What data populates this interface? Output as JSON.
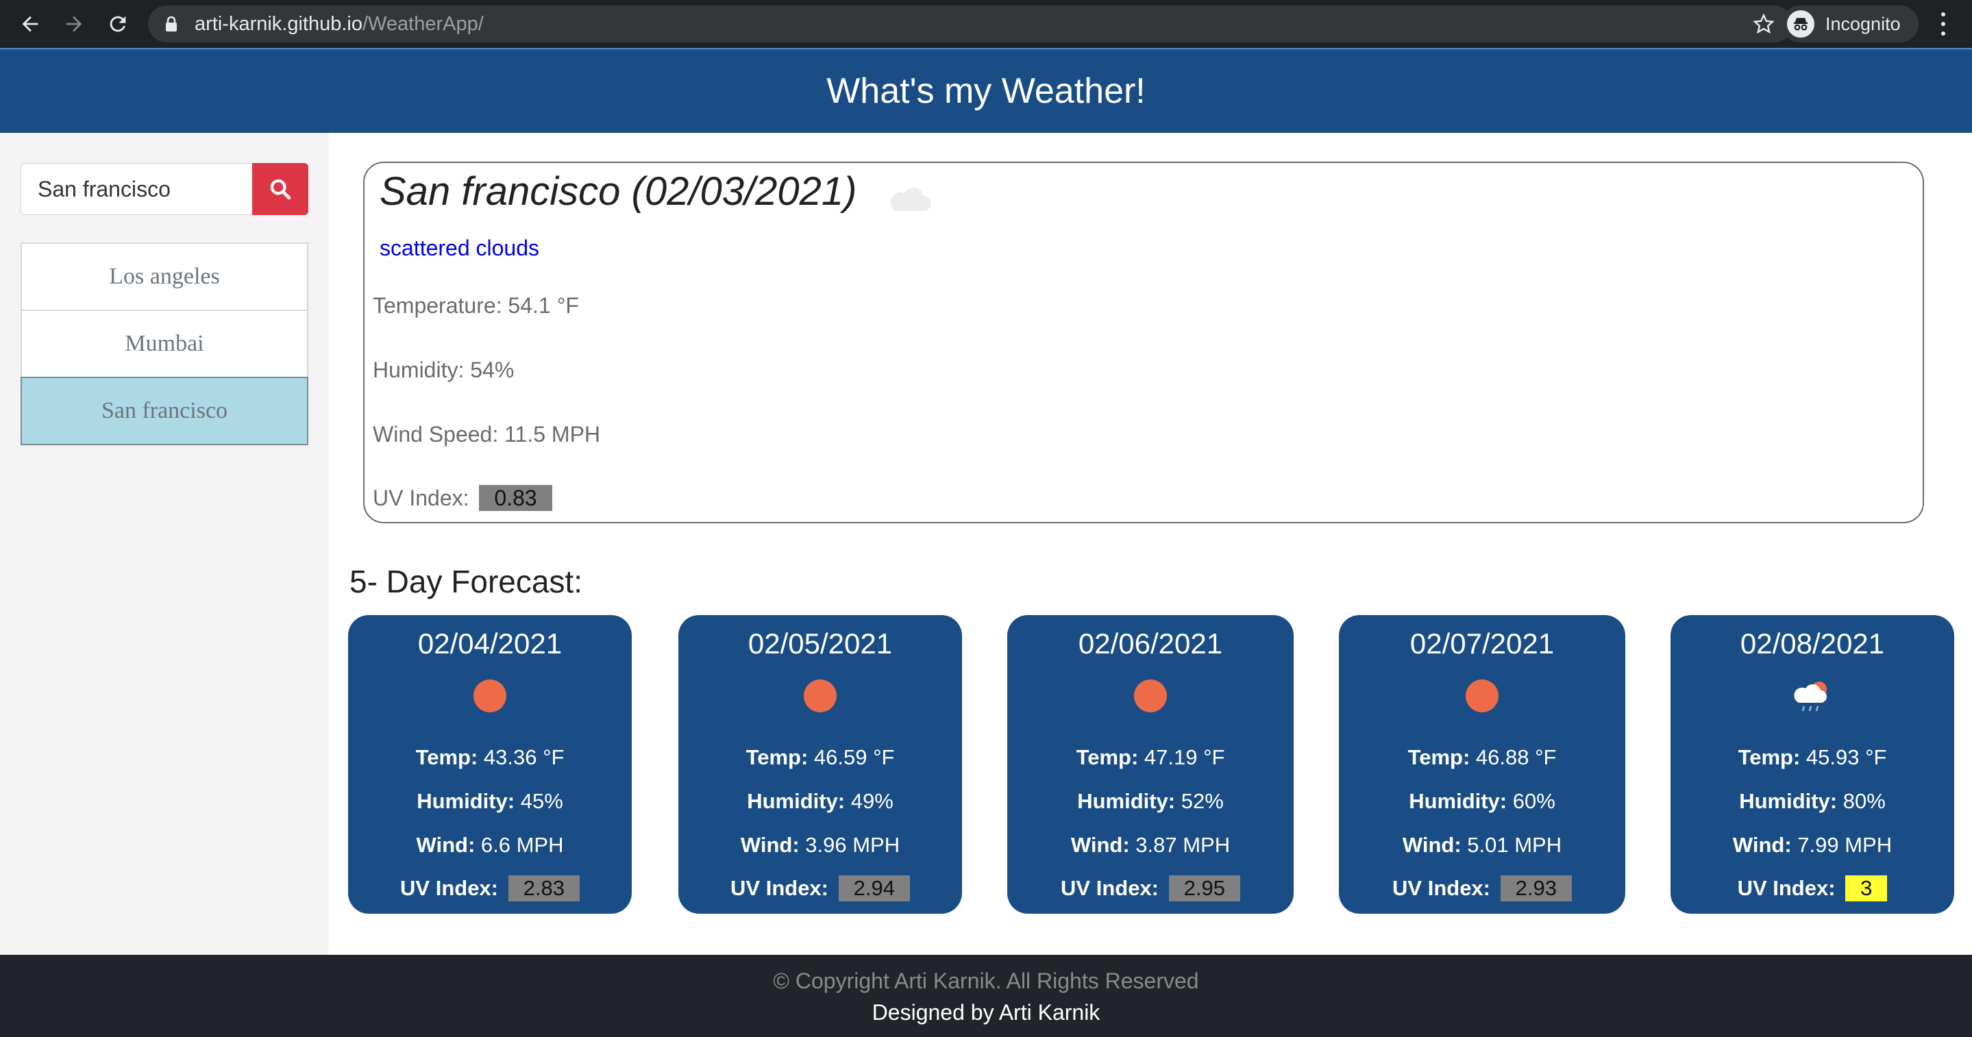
{
  "browser": {
    "url_host": "arti-karnik.github.io",
    "url_path": "/WeatherApp/",
    "profile_label": "Incognito",
    "icons": [
      "back-arrow-icon",
      "forward-arrow-icon",
      "reload-icon",
      "lock-icon",
      "bookmark-star-icon",
      "incognito-icon",
      "more-vert-icon"
    ]
  },
  "header": {
    "title": "What's my Weather!",
    "background_color": "#1a4d85"
  },
  "sidebar": {
    "search": {
      "value": "San francisco",
      "button_icon": "search-icon",
      "button_color": "#dc3545"
    },
    "cities": [
      {
        "label": "Los angeles",
        "active": false
      },
      {
        "label": "Mumbai",
        "active": false
      },
      {
        "label": "San francisco",
        "active": true
      }
    ],
    "active_color": "#add8e6"
  },
  "current": {
    "title": "San francisco (02/03/2021)",
    "icon": "cloud-icon",
    "description": "scattered clouds",
    "temperature": "Temperature: 54.1 °F",
    "humidity": "Humidity: 54%",
    "wind": "Wind Speed: 11.5 MPH",
    "uv_label": "UV Index:",
    "uv_value": "0.83"
  },
  "forecast": {
    "heading": "5- Day Forecast:",
    "labels": {
      "temp": "Temp:",
      "humidity": "Humidity:",
      "wind": "Wind:",
      "uv": "UV Index:"
    },
    "days": [
      {
        "date": "02/04/2021",
        "icon": "sun-icon",
        "temp": "43.36 °F",
        "humidity": "45%",
        "wind": "6.6 MPH",
        "uv": "2.83",
        "uv_color": "#808080"
      },
      {
        "date": "02/05/2021",
        "icon": "sun-icon",
        "temp": "46.59 °F",
        "humidity": "49%",
        "wind": "3.96 MPH",
        "uv": "2.94",
        "uv_color": "#808080"
      },
      {
        "date": "02/06/2021",
        "icon": "sun-icon",
        "temp": "47.19 °F",
        "humidity": "52%",
        "wind": "3.87 MPH",
        "uv": "2.95",
        "uv_color": "#808080"
      },
      {
        "date": "02/07/2021",
        "icon": "sun-icon",
        "temp": "46.88 °F",
        "humidity": "60%",
        "wind": "5.01 MPH",
        "uv": "2.93",
        "uv_color": "#808080"
      },
      {
        "date": "02/08/2021",
        "icon": "sun-cloud-rain-icon",
        "temp": "45.93 °F",
        "humidity": "80%",
        "wind": "7.99 MPH",
        "uv": "3",
        "uv_color": "#ffff33"
      }
    ]
  },
  "footer": {
    "copyright": "© Copyright Arti Karnik. All Rights Reserved",
    "designed_by": "Designed by Arti Karnik"
  }
}
